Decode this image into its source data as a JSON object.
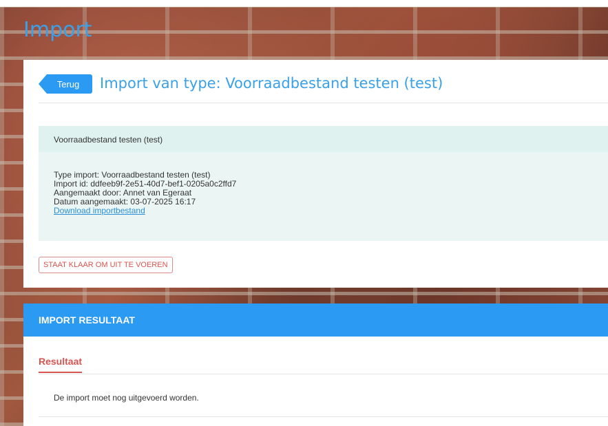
{
  "page": {
    "heading": "Import"
  },
  "header": {
    "back_label": "Terug",
    "title": "Import van type: Voorraadbestand testen (test)"
  },
  "info": {
    "name": "Voorraadbestand testen (test)",
    "type_line": "Type import: Voorraadbestand testen (test)",
    "id_line": "Import id: ddfeeb9f-2e51-40d7-bef1-0205a0c2ffd7",
    "created_by_line": "Aangemaakt door: Annet van Egeraat",
    "created_date_line": "Datum aangemaakt: 03-07-2025 16:17",
    "download_label": "Download importbestand"
  },
  "status": {
    "label": "STAAT KLAAR OM UIT TE VOEREN",
    "color": "#d9534f"
  },
  "result": {
    "section_title": "IMPORT RESULTAAT",
    "tab_label": "Resultaat",
    "message": "De import moet nog uitgevoerd worden."
  },
  "colors": {
    "accent": "#2b9af3",
    "heading": "#3aa0e8",
    "info_bg": "#ebf6f4"
  }
}
